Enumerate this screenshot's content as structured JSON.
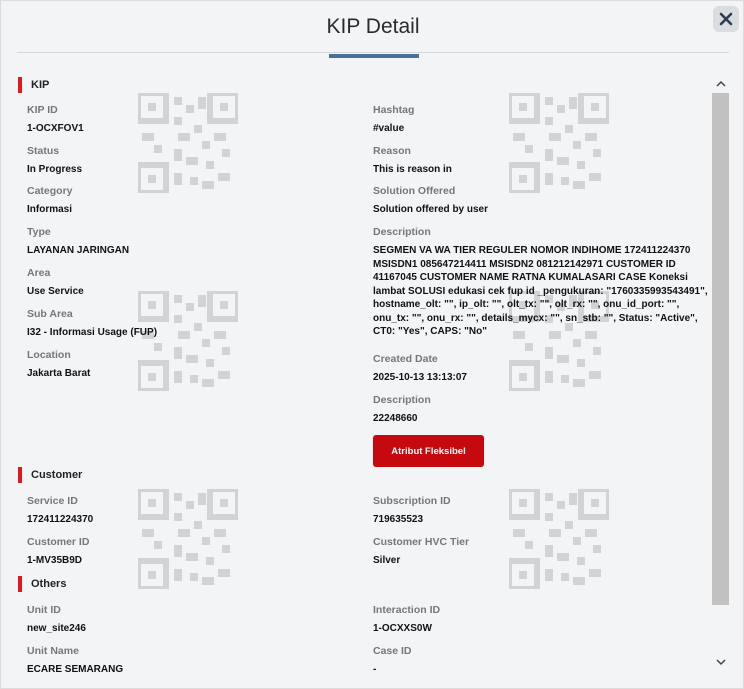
{
  "modal": {
    "title": "KIP Detail",
    "close_icon": "close-icon"
  },
  "sections": {
    "kip": {
      "title": "KIP"
    },
    "customer": {
      "title": "Customer"
    },
    "others": {
      "title": "Others"
    }
  },
  "kip": {
    "kip_id": {
      "label": "KIP ID",
      "value": "1-OCXFOV1"
    },
    "status": {
      "label": "Status",
      "value": "In Progress"
    },
    "category": {
      "label": "Category",
      "value": "Informasi"
    },
    "type": {
      "label": "Type",
      "value": "LAYANAN JARINGAN"
    },
    "area": {
      "label": "Area",
      "value": "Use Service"
    },
    "sub_area": {
      "label": "Sub Area",
      "value": "I32 - Informasi Usage (FUP)"
    },
    "location": {
      "label": "Location",
      "value": "Jakarta Barat"
    },
    "hashtag": {
      "label": "Hashtag",
      "value": "#value"
    },
    "reason": {
      "label": "Reason",
      "value": "This is reason in"
    },
    "solution_offered": {
      "label": "Solution Offered",
      "value": "Solution offered by user"
    },
    "description": {
      "label": "Description",
      "value": "SEGMEN VA WA TIER REGULER NOMOR INDIHOME 172411224370 MSISDN1 085647214411 MSISDN2 081212142971 CUSTOMER ID 41167045 CUSTOMER NAME RATNA KUMALASARI CASE Koneksi lambat SOLUSI edukasi cek fup id _pengukuran: \"1760335993543491\", hostname_olt: \"\", ip_olt: \"\", olt_tx: \"\", olt_rx: \"\", onu_id_port: \"\", onu_tx: \"\", onu_rx: \"\", details_mycx: \"\", sn_stb: \"\", Status: \"Active\", CT0: \"Yes\", CAPS: \"No\""
    },
    "created_date": {
      "label": "Created Date",
      "value": "2025-10-13 13:13:07"
    },
    "description2": {
      "label": "Description",
      "value": "22248660"
    },
    "atribut_button": "Atribut Fleksibel"
  },
  "customer": {
    "service_id": {
      "label": "Service ID",
      "value": "172411224370"
    },
    "customer_id": {
      "label": "Customer ID",
      "value": "1-MV35B9D"
    },
    "subscription_id": {
      "label": "Subscription ID",
      "value": "719635523"
    },
    "customer_hvc_tier": {
      "label": "Customer HVC Tier",
      "value": "Silver"
    }
  },
  "others": {
    "unit_id": {
      "label": "Unit ID",
      "value": "new_site246"
    },
    "unit_name": {
      "label": "Unit Name",
      "value": "ECARE SEMARANG"
    },
    "interaction_id": {
      "label": "Interaction ID",
      "value": "1-OCXXS0W"
    },
    "case_id": {
      "label": "Case ID",
      "value": "-"
    }
  },
  "colors": {
    "accent_red": "#e0191f",
    "button_red": "#c5090f",
    "title_underline": "#4a6f99"
  }
}
